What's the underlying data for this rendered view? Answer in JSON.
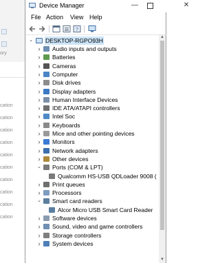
{
  "background_window": {
    "labels": [
      "ory",
      "cation",
      "cation",
      "cation",
      "cation",
      "cation",
      "cation",
      "cation",
      "cation",
      "cation",
      "cation"
    ]
  },
  "window": {
    "title": "Device Manager",
    "controls": {
      "minimize": "—",
      "close": "✕"
    }
  },
  "menu": [
    "File",
    "Action",
    "View",
    "Help"
  ],
  "tree": {
    "root": "DESKTOP-RGPO93H",
    "items": [
      {
        "label": "Audio inputs and outputs",
        "icon": "audio-icon",
        "state": "collapsed"
      },
      {
        "label": "Batteries",
        "icon": "battery-icon",
        "state": "collapsed"
      },
      {
        "label": "Cameras",
        "icon": "camera-icon",
        "state": "collapsed"
      },
      {
        "label": "Computer",
        "icon": "computer-icon",
        "state": "collapsed"
      },
      {
        "label": "Disk drives",
        "icon": "disk-icon",
        "state": "collapsed"
      },
      {
        "label": "Display adapters",
        "icon": "display-icon",
        "state": "collapsed"
      },
      {
        "label": "Human Interface Devices",
        "icon": "hid-icon",
        "state": "collapsed"
      },
      {
        "label": "IDE ATA/ATAPI controllers",
        "icon": "ide-icon",
        "state": "collapsed"
      },
      {
        "label": "Intel Soc",
        "icon": "soc-icon",
        "state": "collapsed"
      },
      {
        "label": "Keyboards",
        "icon": "keyboard-icon",
        "state": "collapsed"
      },
      {
        "label": "Mice and other pointing devices",
        "icon": "mouse-icon",
        "state": "collapsed"
      },
      {
        "label": "Monitors",
        "icon": "monitor-icon",
        "state": "collapsed"
      },
      {
        "label": "Network adapters",
        "icon": "network-icon",
        "state": "collapsed"
      },
      {
        "label": "Other devices",
        "icon": "other-icon",
        "state": "collapsed"
      },
      {
        "label": "Ports (COM & LPT)",
        "icon": "port-icon",
        "state": "expanded"
      },
      {
        "label": "Qualcomm HS-USB QDLoader 9008 (",
        "icon": "port-device-icon",
        "state": "child"
      },
      {
        "label": "Print queues",
        "icon": "printer-icon",
        "state": "collapsed"
      },
      {
        "label": "Processors",
        "icon": "processor-icon",
        "state": "collapsed"
      },
      {
        "label": "Smart card readers",
        "icon": "smartcard-icon",
        "state": "expanded"
      },
      {
        "label": "Alcor Micro USB Smart Card Reader",
        "icon": "smartcard-device-icon",
        "state": "child"
      },
      {
        "label": "Software devices",
        "icon": "software-icon",
        "state": "collapsed"
      },
      {
        "label": "Sound, video and game controllers",
        "icon": "sound-icon",
        "state": "collapsed"
      },
      {
        "label": "Storage controllers",
        "icon": "storage-icon",
        "state": "collapsed"
      },
      {
        "label": "System devices",
        "icon": "system-icon",
        "state": "collapsed"
      }
    ]
  },
  "colors": {
    "selection": "#cce4f7",
    "scroll_thumb": "#c2c2c2"
  }
}
